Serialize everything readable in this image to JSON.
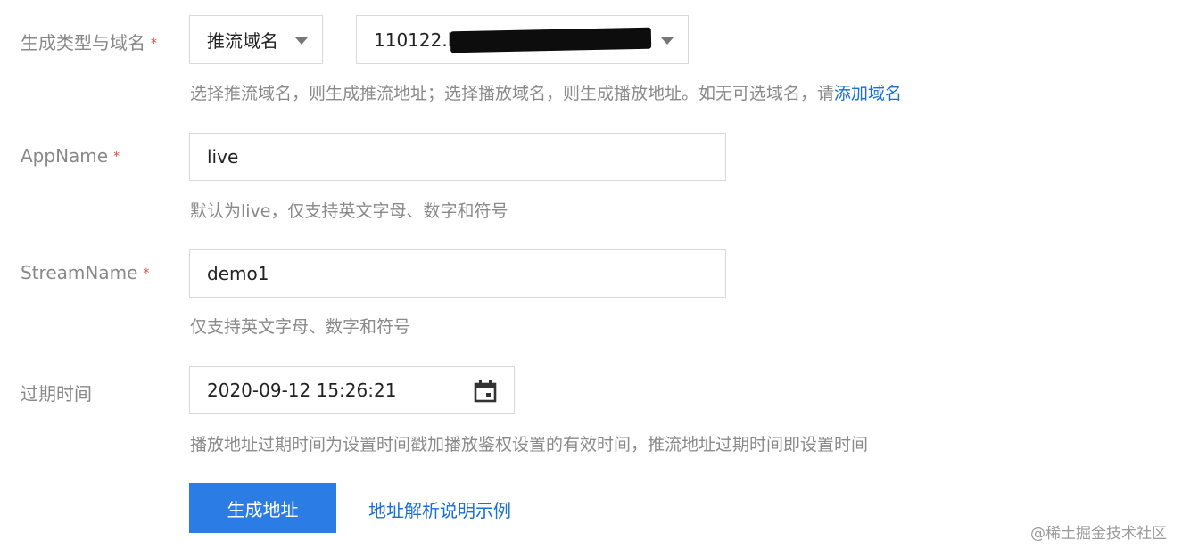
{
  "form": {
    "type_domain": {
      "label": "生成类型与域名",
      "required_mark": "*",
      "type_select_value": "推流域名",
      "domain_select_value": "110122.li",
      "hint_text": "选择推流域名，则生成推流地址；选择播放域名，则生成播放地址。如无可选域名，请",
      "hint_link": "添加域名"
    },
    "app_name": {
      "label": "AppName",
      "required_mark": "*",
      "value": "live",
      "hint": "默认为live，仅支持英文字母、数字和符号"
    },
    "stream_name": {
      "label": "StreamName",
      "required_mark": "*",
      "value": "demo1",
      "hint": "仅支持英文字母、数字和符号"
    },
    "expire_time": {
      "label": "过期时间",
      "value": "2020-09-12 15:26:21",
      "icon": "calendar-icon",
      "hint": "播放地址过期时间为设置时间戳加播放鉴权设置的有效时间，推流地址过期时间即设置时间"
    }
  },
  "actions": {
    "generate_label": "生成地址",
    "example_link": "地址解析说明示例"
  },
  "watermark": "@稀土掘金技术社区",
  "colors": {
    "primary": "#2c7ce6",
    "link": "#1a6fd6",
    "required": "#e54545",
    "label": "#888888",
    "hint": "#8a8a8a",
    "border": "#d9d9d9"
  }
}
